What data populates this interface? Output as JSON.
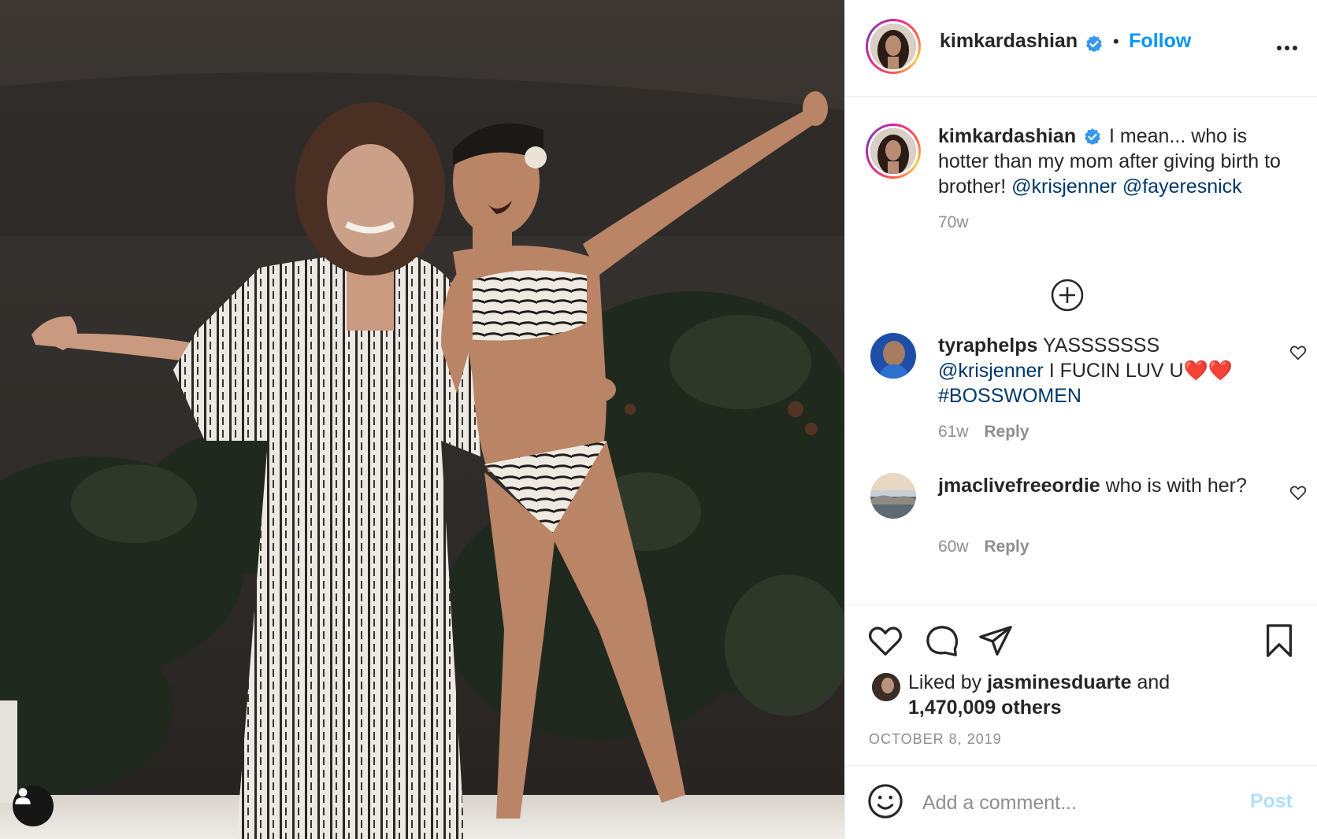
{
  "header": {
    "username": "kimkardashian",
    "separator": "•",
    "follow_label": "Follow"
  },
  "caption": {
    "username": "kimkardashian",
    "text": "I mean... who is hotter than my mom after giving birth to brother!",
    "mention_1": "@krisjenner",
    "mention_2": "@fayeresnick",
    "time": "70w"
  },
  "comments": [
    {
      "username": "tyraphelps",
      "text_1": "YASSSSSSS",
      "mention": "@krisjenner",
      "text_2": "I FUCIN LUV U❤️❤️",
      "hashtag": "#BOSSWOMEN",
      "time": "61w",
      "reply_label": "Reply"
    },
    {
      "username": "jmaclivefreeordie",
      "text": "who is with her?",
      "time": "60w",
      "reply_label": "Reply"
    }
  ],
  "likes": {
    "prefix": "Liked by",
    "user": "jasminesduarte",
    "connector": "and",
    "others": "1,470,009 others"
  },
  "date": "OCTOBER 8, 2019",
  "add_comment": {
    "placeholder": "Add a comment...",
    "post_label": "Post"
  },
  "icons": {
    "verified": "verified-badge-icon",
    "more": "more-options-icon",
    "load_more": "plus-circle-icon",
    "like": "heart-icon",
    "comment": "speech-bubble-icon",
    "share": "paper-plane-icon",
    "save": "bookmark-icon",
    "emoji": "smiley-icon",
    "tag": "user-tag-icon"
  },
  "colors": {
    "follow": "#0095f6",
    "mention": "#00376b",
    "muted": "#8e8e8e",
    "post_disabled": "#b2dffc"
  }
}
